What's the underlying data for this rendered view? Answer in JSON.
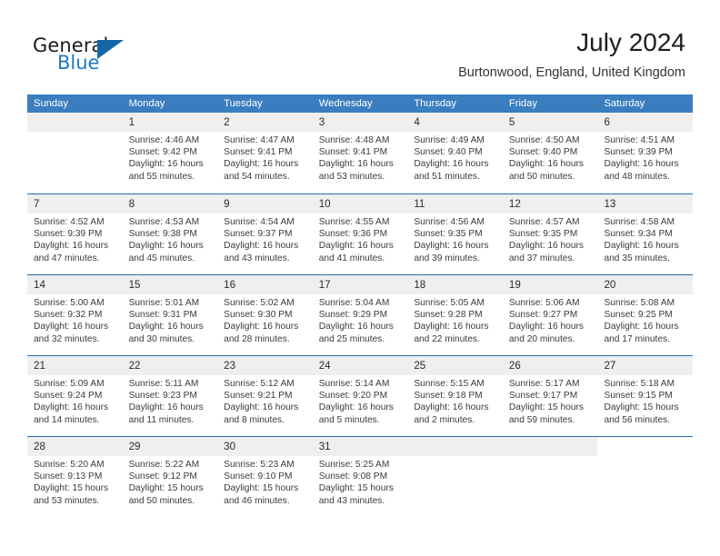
{
  "brand": {
    "word_general": "General",
    "word_blue": "Blue",
    "logo_icon": "blue-triangle-icon",
    "accent_color": "#2179bf"
  },
  "header": {
    "title": "July 2024",
    "subtitle": "Burtonwood, England, United Kingdom"
  },
  "calendar": {
    "header_bg": "#3a7ebf",
    "row_border": "#2b6ca8",
    "daynum_band": "#efefef",
    "weekday_headers": [
      "Sunday",
      "Monday",
      "Tuesday",
      "Wednesday",
      "Thursday",
      "Friday",
      "Saturday"
    ],
    "weeks": [
      [
        {
          "day": "",
          "sunrise": "",
          "sunset": "",
          "daylight_1": "",
          "daylight_2": ""
        },
        {
          "day": "1",
          "sunrise": "Sunrise: 4:46 AM",
          "sunset": "Sunset: 9:42 PM",
          "daylight_1": "Daylight: 16 hours",
          "daylight_2": "and 55 minutes."
        },
        {
          "day": "2",
          "sunrise": "Sunrise: 4:47 AM",
          "sunset": "Sunset: 9:41 PM",
          "daylight_1": "Daylight: 16 hours",
          "daylight_2": "and 54 minutes."
        },
        {
          "day": "3",
          "sunrise": "Sunrise: 4:48 AM",
          "sunset": "Sunset: 9:41 PM",
          "daylight_1": "Daylight: 16 hours",
          "daylight_2": "and 53 minutes."
        },
        {
          "day": "4",
          "sunrise": "Sunrise: 4:49 AM",
          "sunset": "Sunset: 9:40 PM",
          "daylight_1": "Daylight: 16 hours",
          "daylight_2": "and 51 minutes."
        },
        {
          "day": "5",
          "sunrise": "Sunrise: 4:50 AM",
          "sunset": "Sunset: 9:40 PM",
          "daylight_1": "Daylight: 16 hours",
          "daylight_2": "and 50 minutes."
        },
        {
          "day": "6",
          "sunrise": "Sunrise: 4:51 AM",
          "sunset": "Sunset: 9:39 PM",
          "daylight_1": "Daylight: 16 hours",
          "daylight_2": "and 48 minutes."
        }
      ],
      [
        {
          "day": "7",
          "sunrise": "Sunrise: 4:52 AM",
          "sunset": "Sunset: 9:39 PM",
          "daylight_1": "Daylight: 16 hours",
          "daylight_2": "and 47 minutes."
        },
        {
          "day": "8",
          "sunrise": "Sunrise: 4:53 AM",
          "sunset": "Sunset: 9:38 PM",
          "daylight_1": "Daylight: 16 hours",
          "daylight_2": "and 45 minutes."
        },
        {
          "day": "9",
          "sunrise": "Sunrise: 4:54 AM",
          "sunset": "Sunset: 9:37 PM",
          "daylight_1": "Daylight: 16 hours",
          "daylight_2": "and 43 minutes."
        },
        {
          "day": "10",
          "sunrise": "Sunrise: 4:55 AM",
          "sunset": "Sunset: 9:36 PM",
          "daylight_1": "Daylight: 16 hours",
          "daylight_2": "and 41 minutes."
        },
        {
          "day": "11",
          "sunrise": "Sunrise: 4:56 AM",
          "sunset": "Sunset: 9:35 PM",
          "daylight_1": "Daylight: 16 hours",
          "daylight_2": "and 39 minutes."
        },
        {
          "day": "12",
          "sunrise": "Sunrise: 4:57 AM",
          "sunset": "Sunset: 9:35 PM",
          "daylight_1": "Daylight: 16 hours",
          "daylight_2": "and 37 minutes."
        },
        {
          "day": "13",
          "sunrise": "Sunrise: 4:58 AM",
          "sunset": "Sunset: 9:34 PM",
          "daylight_1": "Daylight: 16 hours",
          "daylight_2": "and 35 minutes."
        }
      ],
      [
        {
          "day": "14",
          "sunrise": "Sunrise: 5:00 AM",
          "sunset": "Sunset: 9:32 PM",
          "daylight_1": "Daylight: 16 hours",
          "daylight_2": "and 32 minutes."
        },
        {
          "day": "15",
          "sunrise": "Sunrise: 5:01 AM",
          "sunset": "Sunset: 9:31 PM",
          "daylight_1": "Daylight: 16 hours",
          "daylight_2": "and 30 minutes."
        },
        {
          "day": "16",
          "sunrise": "Sunrise: 5:02 AM",
          "sunset": "Sunset: 9:30 PM",
          "daylight_1": "Daylight: 16 hours",
          "daylight_2": "and 28 minutes."
        },
        {
          "day": "17",
          "sunrise": "Sunrise: 5:04 AM",
          "sunset": "Sunset: 9:29 PM",
          "daylight_1": "Daylight: 16 hours",
          "daylight_2": "and 25 minutes."
        },
        {
          "day": "18",
          "sunrise": "Sunrise: 5:05 AM",
          "sunset": "Sunset: 9:28 PM",
          "daylight_1": "Daylight: 16 hours",
          "daylight_2": "and 22 minutes."
        },
        {
          "day": "19",
          "sunrise": "Sunrise: 5:06 AM",
          "sunset": "Sunset: 9:27 PM",
          "daylight_1": "Daylight: 16 hours",
          "daylight_2": "and 20 minutes."
        },
        {
          "day": "20",
          "sunrise": "Sunrise: 5:08 AM",
          "sunset": "Sunset: 9:25 PM",
          "daylight_1": "Daylight: 16 hours",
          "daylight_2": "and 17 minutes."
        }
      ],
      [
        {
          "day": "21",
          "sunrise": "Sunrise: 5:09 AM",
          "sunset": "Sunset: 9:24 PM",
          "daylight_1": "Daylight: 16 hours",
          "daylight_2": "and 14 minutes."
        },
        {
          "day": "22",
          "sunrise": "Sunrise: 5:11 AM",
          "sunset": "Sunset: 9:23 PM",
          "daylight_1": "Daylight: 16 hours",
          "daylight_2": "and 11 minutes."
        },
        {
          "day": "23",
          "sunrise": "Sunrise: 5:12 AM",
          "sunset": "Sunset: 9:21 PM",
          "daylight_1": "Daylight: 16 hours",
          "daylight_2": "and 8 minutes."
        },
        {
          "day": "24",
          "sunrise": "Sunrise: 5:14 AM",
          "sunset": "Sunset: 9:20 PM",
          "daylight_1": "Daylight: 16 hours",
          "daylight_2": "and 5 minutes."
        },
        {
          "day": "25",
          "sunrise": "Sunrise: 5:15 AM",
          "sunset": "Sunset: 9:18 PM",
          "daylight_1": "Daylight: 16 hours",
          "daylight_2": "and 2 minutes."
        },
        {
          "day": "26",
          "sunrise": "Sunrise: 5:17 AM",
          "sunset": "Sunset: 9:17 PM",
          "daylight_1": "Daylight: 15 hours",
          "daylight_2": "and 59 minutes."
        },
        {
          "day": "27",
          "sunrise": "Sunrise: 5:18 AM",
          "sunset": "Sunset: 9:15 PM",
          "daylight_1": "Daylight: 15 hours",
          "daylight_2": "and 56 minutes."
        }
      ],
      [
        {
          "day": "28",
          "sunrise": "Sunrise: 5:20 AM",
          "sunset": "Sunset: 9:13 PM",
          "daylight_1": "Daylight: 15 hours",
          "daylight_2": "and 53 minutes."
        },
        {
          "day": "29",
          "sunrise": "Sunrise: 5:22 AM",
          "sunset": "Sunset: 9:12 PM",
          "daylight_1": "Daylight: 15 hours",
          "daylight_2": "and 50 minutes."
        },
        {
          "day": "30",
          "sunrise": "Sunrise: 5:23 AM",
          "sunset": "Sunset: 9:10 PM",
          "daylight_1": "Daylight: 15 hours",
          "daylight_2": "and 46 minutes."
        },
        {
          "day": "31",
          "sunrise": "Sunrise: 5:25 AM",
          "sunset": "Sunset: 9:08 PM",
          "daylight_1": "Daylight: 15 hours",
          "daylight_2": "and 43 minutes."
        },
        {
          "day": "",
          "sunrise": "",
          "sunset": "",
          "daylight_1": "",
          "daylight_2": ""
        },
        {
          "day": "",
          "sunrise": "",
          "sunset": "",
          "daylight_1": "",
          "daylight_2": ""
        },
        {
          "day": "",
          "sunrise": "",
          "sunset": "",
          "daylight_1": "",
          "daylight_2": ""
        }
      ]
    ]
  }
}
